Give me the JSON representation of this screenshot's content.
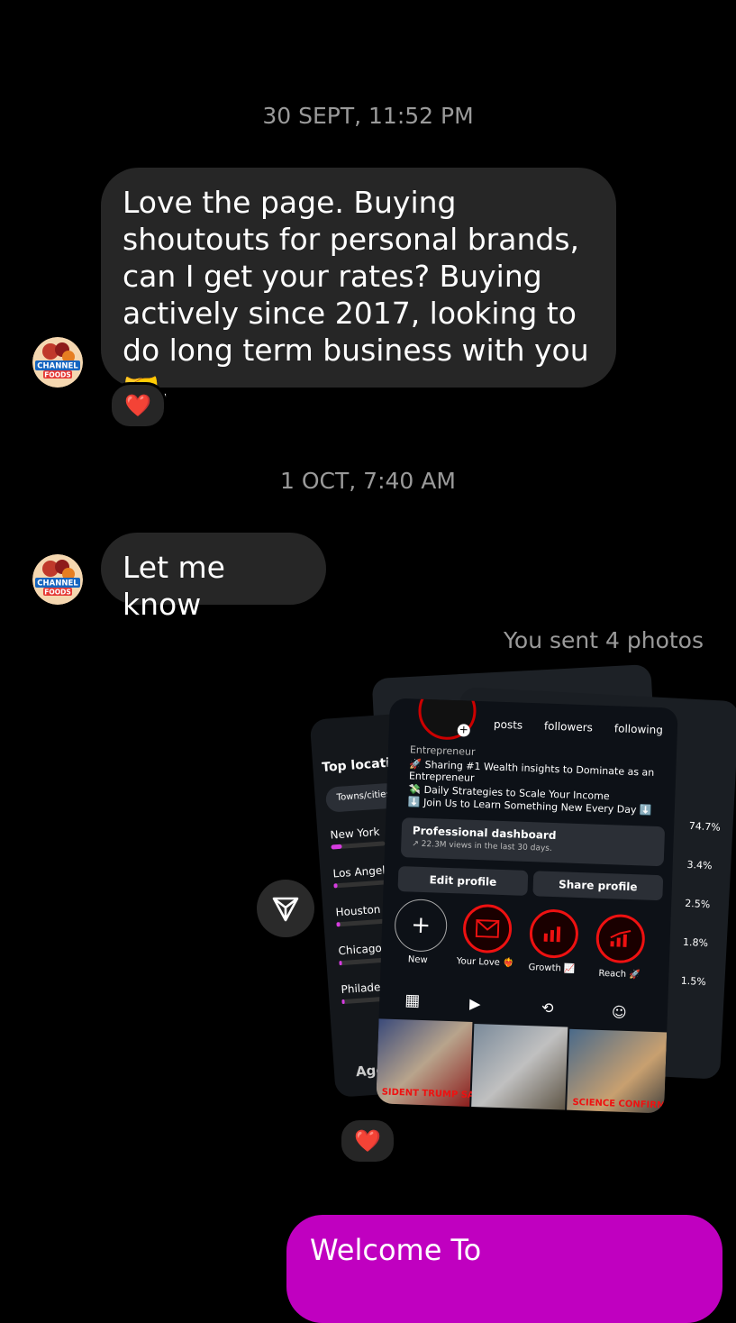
{
  "messages": {
    "timestamp1": "30 SEPT, 11:52 PM",
    "msg1": "Love the page. Buying shoutouts for personal brands, can I get your rates? Buying actively since 2017, looking to do long term business with you 🤝.",
    "react1": "❤️",
    "timestamp2": "1 OCT, 7:40 AM",
    "msg2": "Let me know",
    "sent_note": "You sent 4 photos",
    "react2": "❤️",
    "outgoing_preview": "Welcome To"
  },
  "sender": {
    "avatar_text_top": "CHANNEL",
    "avatar_text_bottom": "FOODS"
  },
  "photo_back": {
    "title": "Top locatio",
    "filter": "Towns/cities",
    "cities": [
      {
        "name": "New York",
        "pct": "74.7%",
        "fill": 0.747
      },
      {
        "name": "Los Angele",
        "pct": "3.4%",
        "fill": 0.034
      },
      {
        "name": "Houston",
        "pct": "2.5%",
        "fill": 0.025
      },
      {
        "name": "Chicago",
        "pct": "1.8%",
        "fill": 0.018
      },
      {
        "name": "Philade",
        "pct": "1.5%",
        "fill": 0.015
      }
    ],
    "age_label": "Age"
  },
  "photo_front": {
    "stats": [
      "posts",
      "followers",
      "following"
    ],
    "category": "Entrepreneur",
    "bio1": "🚀 Sharing #1 Wealth insights to Dominate as an Entrepreneur",
    "bio2": "💸 Daily Strategies to Scale Your Income",
    "bio3": "⬇️ Join Us to Learn Something New Every Day ⬇️",
    "dashboard_title": "Professional dashboard",
    "dashboard_sub": "↗ 22.3M views in the last 30 days.",
    "edit_profile": "Edit profile",
    "share_profile": "Share profile",
    "highlights": [
      "New",
      "Your Love ❤️‍🔥",
      "Growth 📈",
      "Reach 🚀"
    ],
    "thumb_caption1": "SIDENT TRUMP SAYS",
    "thumb_caption3": "SCIENCE CONFIRMS"
  },
  "colors": {
    "background": "#000000",
    "incoming_bubble": "#262626",
    "outgoing_bubble": "#c000c0",
    "timestamp": "#9a9a9a",
    "accent_bar": "#d63ce0",
    "highlight_ring": "#e11111"
  }
}
